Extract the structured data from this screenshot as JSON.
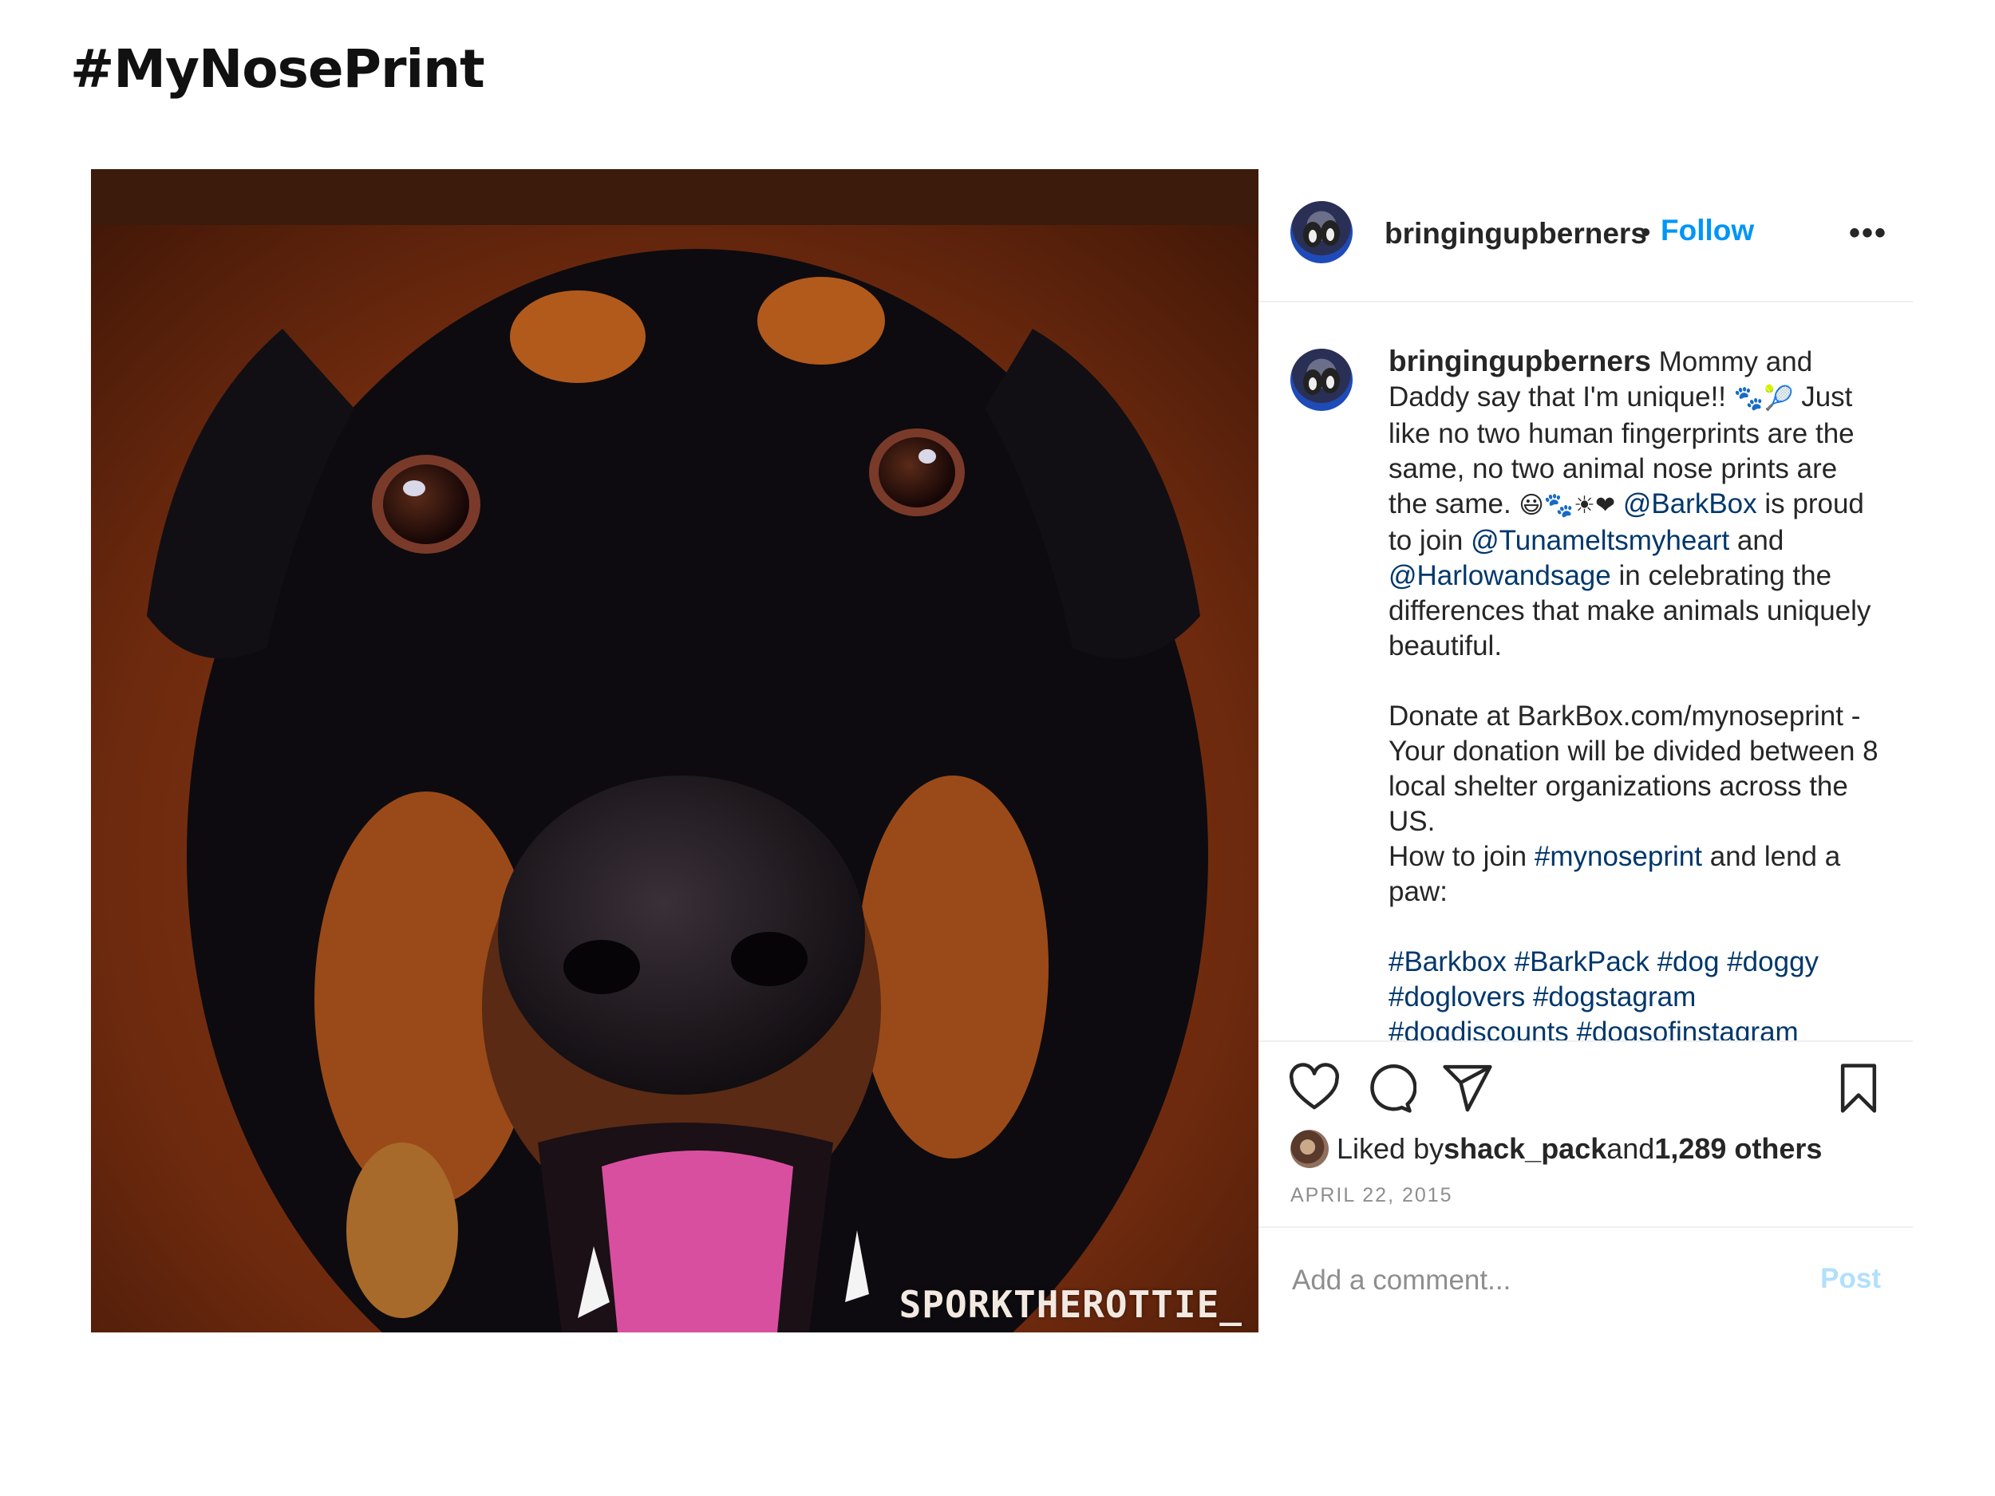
{
  "page": {
    "heading": "#MyNosePrint"
  },
  "post": {
    "image_watermark": "SPORKTHEROTTIE_",
    "header": {
      "username": "bringingupberners",
      "separator": "•",
      "follow_label": "Follow",
      "more_label": "•••"
    },
    "caption": {
      "username": "bringingupberners",
      "p1": [
        {
          "t": " Mommy and Daddy say that I'm unique!! "
        },
        {
          "t": "🐾🎾",
          "emoji": true
        },
        {
          "t": " Just like no two human fingerprints are the same, no two animal nose prints are the same. "
        },
        {
          "t": "😃🐾☀❤",
          "emoji": true
        },
        {
          "t": " "
        },
        {
          "t": "@BarkBox",
          "link": true
        },
        {
          "t": " is proud to join "
        },
        {
          "t": "@Tunameltsmyheart",
          "link": true
        },
        {
          "t": " and "
        },
        {
          "t": "@Harlowandsage",
          "link": true
        },
        {
          "t": " in celebrating the differences that make animals uniquely beautiful."
        }
      ],
      "p2": "Donate at BarkBox.com/mynoseprint - Your donation will be divided between 8 local shelter organizations across the US.",
      "p3": [
        {
          "t": "How to join "
        },
        {
          "t": "#mynoseprint",
          "link": true
        },
        {
          "t": " and lend a paw:"
        }
      ],
      "tags": [
        {
          "t": "#Barkbox",
          "link": true
        },
        {
          "t": " "
        },
        {
          "t": "#BarkPack",
          "link": true
        },
        {
          "t": " "
        },
        {
          "t": "#dog",
          "link": true
        },
        {
          "t": " "
        },
        {
          "t": "#doggy",
          "link": true
        },
        {
          "t": " "
        },
        {
          "t": "#doglovers",
          "link": true
        },
        {
          "t": " "
        },
        {
          "t": "#dogstagram",
          "link": true
        },
        {
          "t": " "
        },
        {
          "t": "#dogdiscounts",
          "link": true
        },
        {
          "t": " "
        },
        {
          "t": "#dogsofinstagram",
          "link": true
        }
      ]
    },
    "actions": {
      "like_icon": "heart-icon",
      "comment_icon": "comment-bubble-icon",
      "share_icon": "paper-plane-icon",
      "save_icon": "bookmark-icon"
    },
    "likes": {
      "prefix": "Liked by ",
      "user": "shack_pack",
      "middle": " and ",
      "count": "1,289 others"
    },
    "date": "APRIL 22, 2015",
    "comment": {
      "placeholder": "Add a comment...",
      "post_label": "Post"
    }
  },
  "colors": {
    "link": "#00376b",
    "follow": "#0095f6",
    "post_disabled": "#b2dffc",
    "muted": "#8e8e8e"
  }
}
